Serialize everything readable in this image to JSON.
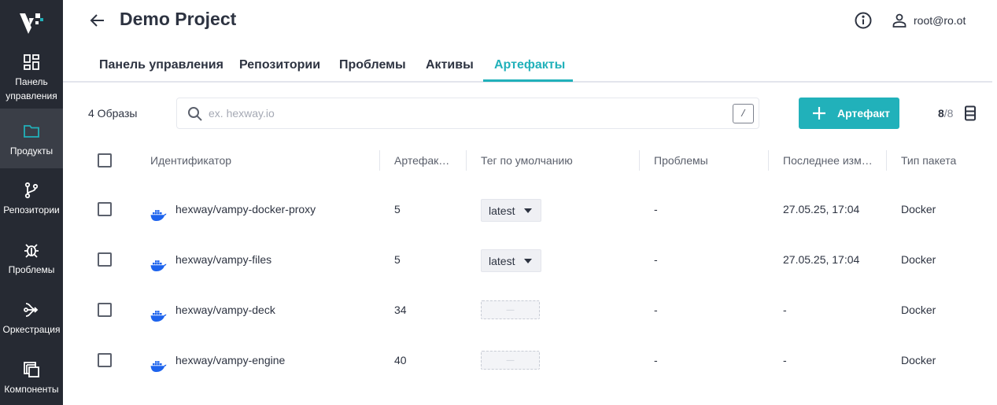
{
  "sidebar": {
    "items": [
      {
        "label": "Панель управления",
        "icon": "dashboard-icon"
      },
      {
        "label": "Продукты",
        "icon": "folder-icon",
        "active": true
      },
      {
        "label": "Репозитории",
        "icon": "branch-icon"
      },
      {
        "label": "Проблемы",
        "icon": "bug-icon"
      },
      {
        "label": "Оркестрация",
        "icon": "orchestration-icon"
      },
      {
        "label": "Компоненты",
        "icon": "components-icon"
      }
    ]
  },
  "header": {
    "title": "Demo Project",
    "user": "root@ro.ot"
  },
  "tabs": [
    "Панель управления",
    "Репозитории",
    "Проблемы",
    "Активы",
    "Артефакты"
  ],
  "active_tab": "Артефакты",
  "toolbar": {
    "count_label": "4 Образы",
    "search_placeholder": "ex. hexway.io",
    "search_shortcut": "/",
    "add_button": "Артефакт",
    "columns_shown": "8",
    "columns_total": "/8"
  },
  "table": {
    "headers": [
      "Идентификатор",
      "Артефак…",
      "Тег по умолчанию",
      "Проблемы",
      "Последнее изм…",
      "Тип пакета"
    ],
    "rows": [
      {
        "name": "hexway/vampy-docker-proxy",
        "artifacts": "5",
        "tag": "latest",
        "issues": "-",
        "modified": "27.05.25, 17:04",
        "type": "Docker"
      },
      {
        "name": "hexway/vampy-files",
        "artifacts": "5",
        "tag": "latest",
        "issues": "-",
        "modified": "27.05.25, 17:04",
        "type": "Docker"
      },
      {
        "name": "hexway/vampy-deck",
        "artifacts": "34",
        "tag": "—",
        "issues": "-",
        "modified": "-",
        "type": "Docker"
      },
      {
        "name": "hexway/vampy-engine",
        "artifacts": "40",
        "tag": "—",
        "issues": "-",
        "modified": "-",
        "type": "Docker"
      }
    ]
  },
  "colors": {
    "accent": "#21b1ba",
    "sidebar": "#262a33",
    "docker": "#1d63ed"
  }
}
